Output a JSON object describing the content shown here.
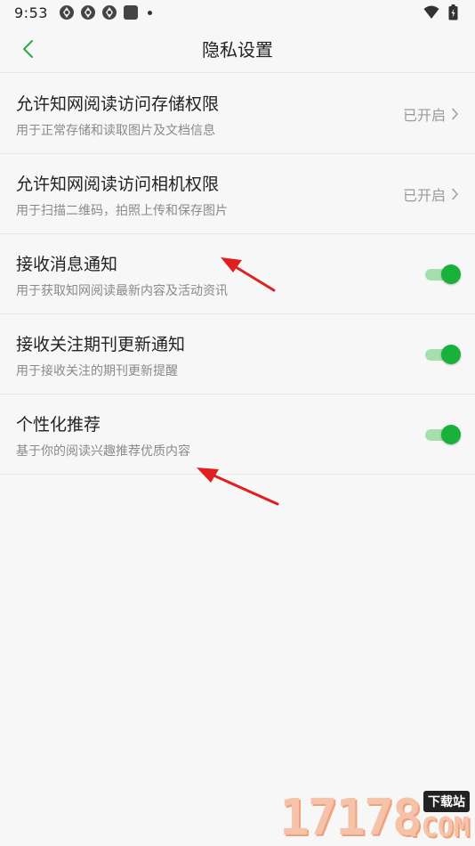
{
  "status_bar": {
    "time": "9:53"
  },
  "header": {
    "title": "隐私设置",
    "back_icon": "chevron-left-icon"
  },
  "settings": [
    {
      "title": "允许知网阅读访问存储权限",
      "desc": "用于正常存储和读取图片及文档信息",
      "type": "link",
      "status": "已开启"
    },
    {
      "title": "允许知网阅读访问相机权限",
      "desc": "用于扫描二维码，拍照上传和保存图片",
      "type": "link",
      "status": "已开启"
    },
    {
      "title": "接收消息通知",
      "desc": "用于获取知网阅读最新内容及活动资讯",
      "type": "toggle",
      "on": true
    },
    {
      "title": "接收关注期刊更新通知",
      "desc": "用于接收关注的期刊更新提醒",
      "type": "toggle",
      "on": true
    },
    {
      "title": "个性化推荐",
      "desc": "基于你的阅读兴趣推荐优质内容",
      "type": "toggle",
      "on": true
    }
  ],
  "watermark": {
    "digits": "17178",
    "badge": "下载站",
    "domain": ".COM"
  },
  "colors": {
    "accent": "#19b03b",
    "accent_track": "#a6dfae",
    "back_icon": "#2aa84a",
    "annotation": "#e02020",
    "background": "#f7f7f7",
    "divider": "#e6e6e6"
  }
}
